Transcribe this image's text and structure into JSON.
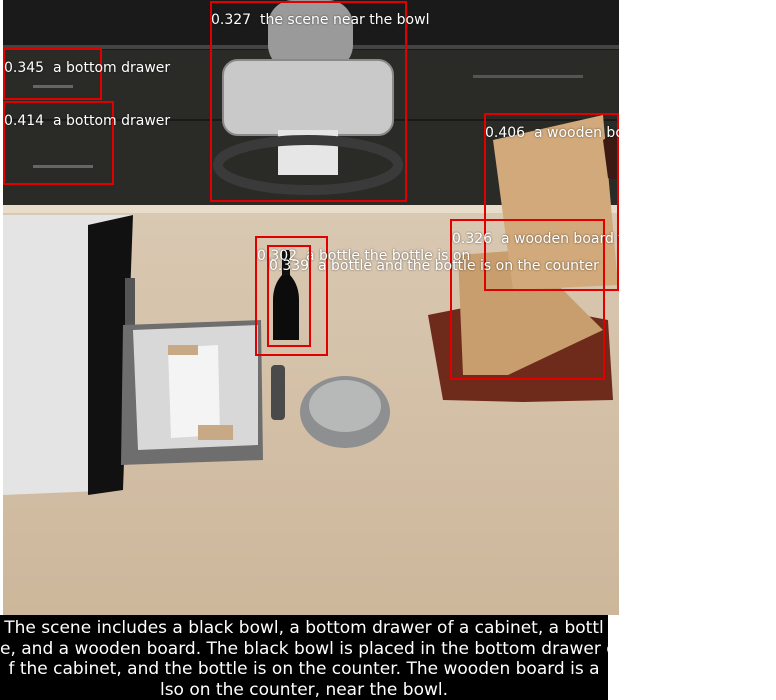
{
  "detections": [
    {
      "score": "0.327",
      "label": "the scene near the bowl"
    },
    {
      "score": "0.345",
      "label": "a bottom drawer"
    },
    {
      "score": "0.414",
      "label": "a bottom drawer"
    },
    {
      "score": "0.406",
      "label": "a wooden board"
    },
    {
      "score": "0.326",
      "label": "a wooden board t"
    },
    {
      "score": "0.302",
      "label": "a bottle the bottle is on"
    },
    {
      "score": "0.339",
      "label": "a bottle and the bottle is on the counter"
    }
  ],
  "caption_lines": [
    "The scene includes a black bowl, a bottom drawer of a cabinet, a bottl",
    "e, and a wooden board. The black bowl is placed in the bottom drawer o",
    "f the cabinet, and the bottle is on the counter. The wooden board is a",
    "lso on the counter, near the bowl."
  ],
  "colors": {
    "box": "#e00000",
    "label_text": "#ffffff",
    "caption_bg": "#000000"
  }
}
